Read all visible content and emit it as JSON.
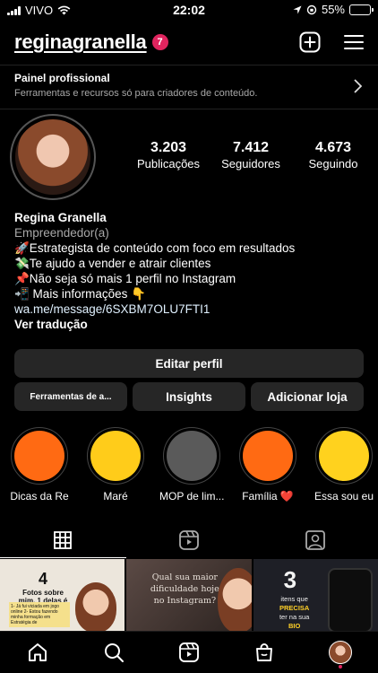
{
  "status": {
    "carrier": "VIVO",
    "time": "22:02",
    "battery": "55%",
    "battery_level": 0.55
  },
  "header": {
    "username": "reginagranella",
    "notification_count": "7",
    "icons": [
      "plus-square-icon",
      "menu-icon"
    ]
  },
  "pro_panel": {
    "title": "Painel profissional",
    "subtitle": "Ferramentas e recursos só para criadores de conteúdo."
  },
  "stats": [
    {
      "value": "3.203",
      "label": "Publicações"
    },
    {
      "value": "7.412",
      "label": "Seguidores"
    },
    {
      "value": "4.673",
      "label": "Seguindo"
    }
  ],
  "bio": {
    "name": "Regina Granella",
    "category": "Empreendedor(a)",
    "lines": [
      "🚀Estrategista de conteúdo com foco em resultados",
      "💸Te ajudo a vender e atrair clientes",
      "📌Não seja só mais 1 perfil no Instagram",
      "📲 Mais informações 👇"
    ],
    "link": "wa.me/message/6SXBM7OLU7FTI1",
    "translate": "Ver tradução"
  },
  "buttons": {
    "edit_profile": "Editar perfil",
    "tools": "Ferramentas de a...",
    "insights": "Insights",
    "add_shop": "Adicionar loja"
  },
  "highlights": [
    {
      "label": "Dicas da Re",
      "color": "#ff6a13"
    },
    {
      "label": "Maré",
      "color": "#ffcc1a"
    },
    {
      "label": "MOP de lim...",
      "color": "#5a5a5a"
    },
    {
      "label": "Família ❤️",
      "color": "#ff6a13"
    },
    {
      "label": "Essa sou eu",
      "color": "#ffd21e"
    }
  ],
  "tabs": [
    "grid-icon",
    "reels-icon",
    "tagged-icon"
  ],
  "posts": {
    "p1": {
      "number": "4",
      "title": "Fotos sobre mim, 1 delas é mentira",
      "note": "1- Já fui viciada em jogo online 2- Estou fazendo minha formação em Estratégia de"
    },
    "p2": {
      "text": "Qual sua maior dificuldade hoje no Instagram?"
    },
    "p3": {
      "number": "3",
      "text_a": "itens que",
      "text_b": "PRECISA",
      "text_c": "ter na sua",
      "text_d": "BIO"
    }
  },
  "colors": {
    "background": "#000000",
    "button": "#262626",
    "badge": "#e0245e",
    "link": "#e0f1ff"
  }
}
